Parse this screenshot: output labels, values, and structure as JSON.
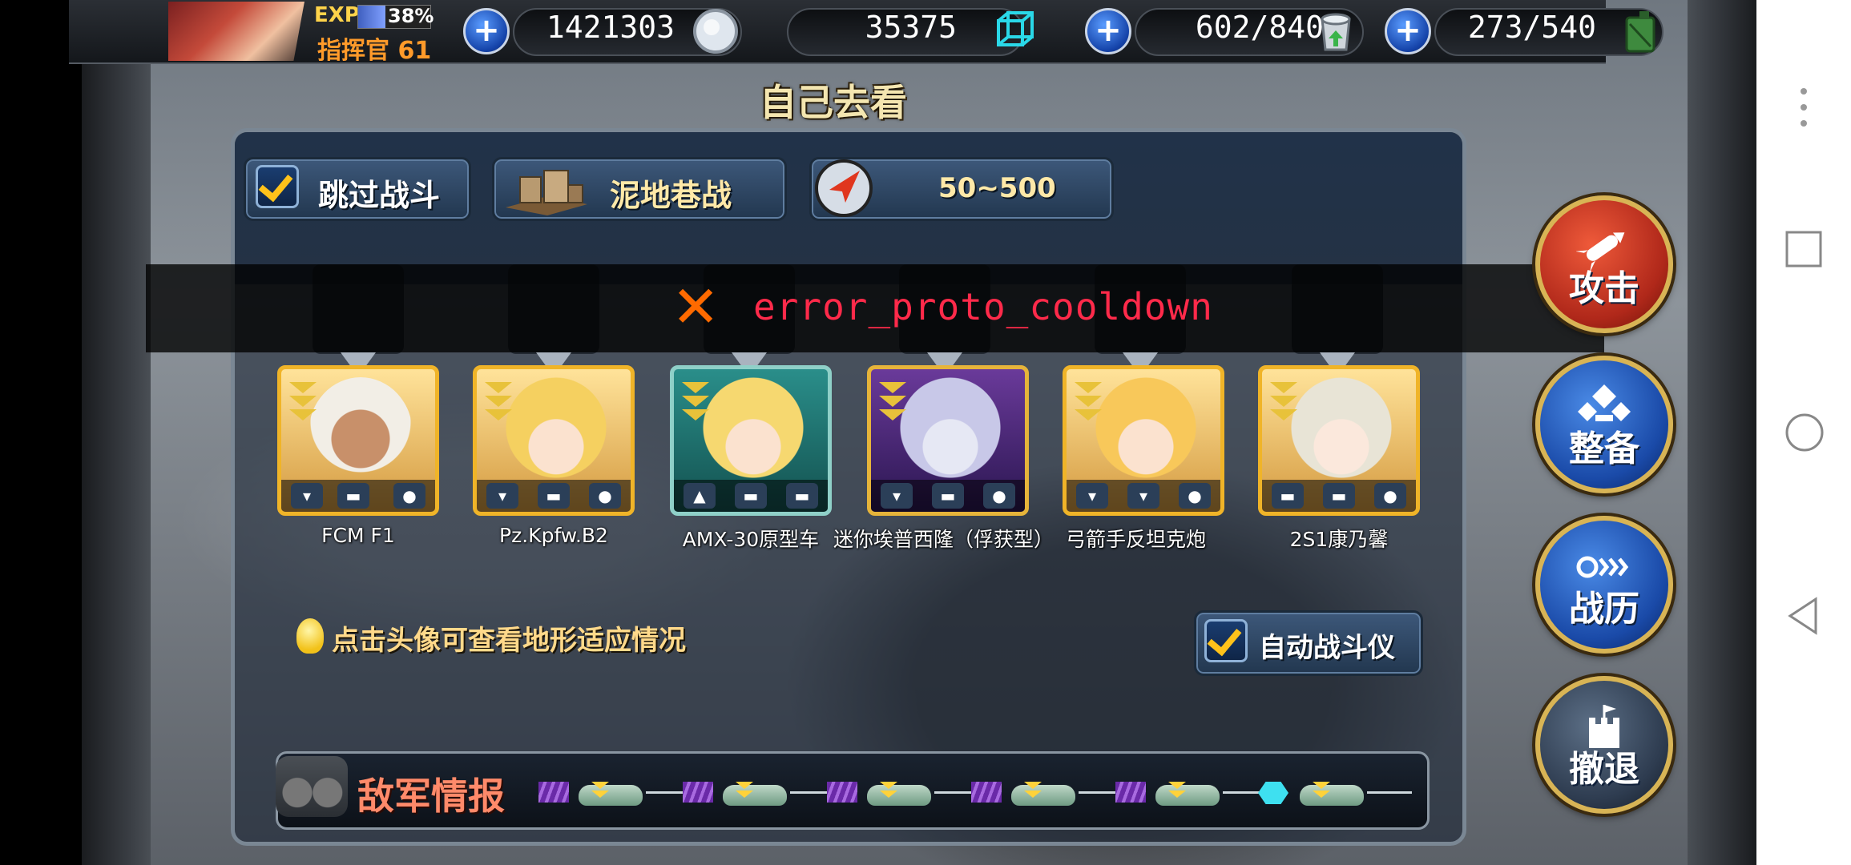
{
  "topbar": {
    "exp_label": "EXP",
    "exp_percent": "38%",
    "exp_fraction": 0.38,
    "commander_label": "指挥官 61",
    "resources": [
      {
        "value": "1421303",
        "icon": "silver-coin-icon"
      },
      {
        "value": "35375",
        "icon": "blue-cube-icon"
      },
      {
        "value": "602/840",
        "icon": "paint-bucket-icon"
      },
      {
        "value": "273/540",
        "icon": "fuel-canister-icon"
      }
    ],
    "plus_symbol": "+"
  },
  "title": "自己去看",
  "options": {
    "skip_battle": "跳过战斗",
    "map_name": "泥地巷战",
    "range": "50~500"
  },
  "error": {
    "symbol": "✕",
    "message": "error_proto_cooldown"
  },
  "units": [
    {
      "name": "FCM F1"
    },
    {
      "name": "Pz.Kpfw.B2"
    },
    {
      "name": "AMX-30原型车"
    },
    {
      "name": "迷你埃普西隆（俘获型）"
    },
    {
      "name": "弓箭手反坦克炮"
    },
    {
      "name": "2S1康乃馨"
    }
  ],
  "hint": "点击头像可查看地形适应情况",
  "auto_battle": "自动战斗仪",
  "enemy_intel": "敌军情报",
  "side_buttons": {
    "attack": "攻击",
    "prepare": "整备",
    "history": "战历",
    "retreat": "撤退"
  },
  "colors": {
    "accent_gold": "#f0b428",
    "error_red": "#ff2a4a",
    "attack_red": "#c8321e",
    "blue_button": "#1e58b8"
  }
}
